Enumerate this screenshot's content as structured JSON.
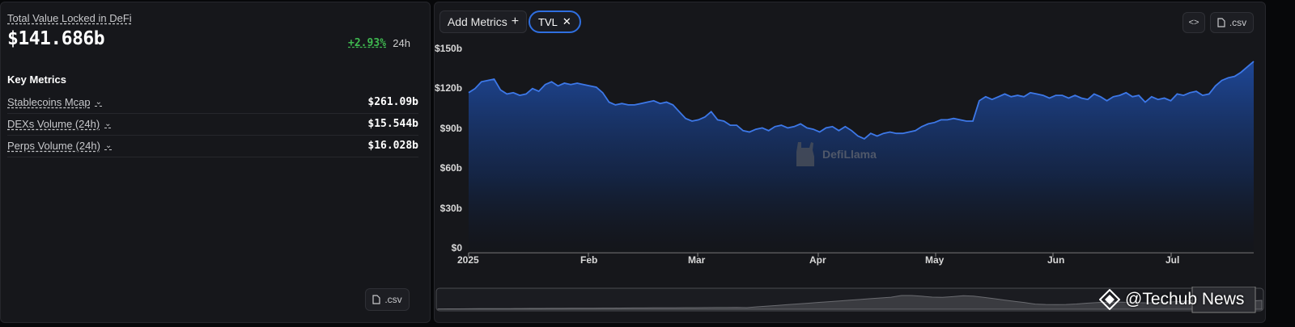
{
  "summary": {
    "tvl_label": "Total Value Locked in DeFi",
    "tvl_value": "$141.686b",
    "change": "+2.93%",
    "change_period": "24h",
    "change_color": "#3fb950"
  },
  "key_metrics": {
    "title": "Key Metrics",
    "items": [
      {
        "label": "Stablecoins Mcap",
        "value": "$261.09b"
      },
      {
        "label": "DEXs Volume (24h)",
        "value": "$15.544b"
      },
      {
        "label": "Perps Volume (24h)",
        "value": "$16.028b"
      }
    ],
    "csv_label": ".csv"
  },
  "toolbar": {
    "add_metrics_label": "Add Metrics",
    "chip_label": "TVL",
    "embed_icon": "code-icon",
    "csv_label": ".csv"
  },
  "watermark": "DefiLlama",
  "brand": "@Techub News",
  "colors": {
    "line": "#3d78e8",
    "fill_top": "#1f4a9e",
    "panel": "#16171b"
  },
  "chart_data": {
    "type": "area",
    "ylim": [
      0,
      150
    ],
    "yticks": [
      "$150b",
      "$120b",
      "$90b",
      "$60b",
      "$30b",
      "$0"
    ],
    "xticks": [
      "2025",
      "Feb",
      "Mar",
      "Apr",
      "May",
      "Jun",
      "Jul"
    ],
    "series": [
      {
        "values": [
          118,
          121,
          126,
          127,
          128,
          120,
          117,
          118,
          116,
          117,
          121,
          119,
          124,
          126,
          123,
          125,
          124,
          125,
          124,
          123,
          122,
          118,
          111,
          109,
          110,
          109,
          109,
          110,
          111,
          112,
          110,
          111,
          109,
          104,
          99,
          97,
          98,
          100,
          104,
          98,
          97,
          94,
          94,
          90,
          89,
          91,
          92,
          90,
          93,
          94,
          92,
          93,
          95,
          92,
          91,
          89,
          92,
          93,
          90,
          93,
          90,
          86,
          84,
          88,
          86,
          88,
          89,
          88,
          88,
          89,
          90,
          93,
          95,
          96,
          98,
          98,
          99,
          98,
          97,
          97,
          112,
          115,
          113,
          115,
          117,
          115,
          116,
          115,
          118,
          117,
          116,
          114,
          116,
          116,
          114,
          116,
          114,
          113,
          117,
          115,
          112,
          115,
          116,
          118,
          115,
          116,
          111,
          115,
          113,
          114,
          112,
          117,
          116,
          118,
          119,
          116,
          117,
          123,
          127,
          129,
          130,
          133,
          137,
          141
        ]
      }
    ]
  }
}
